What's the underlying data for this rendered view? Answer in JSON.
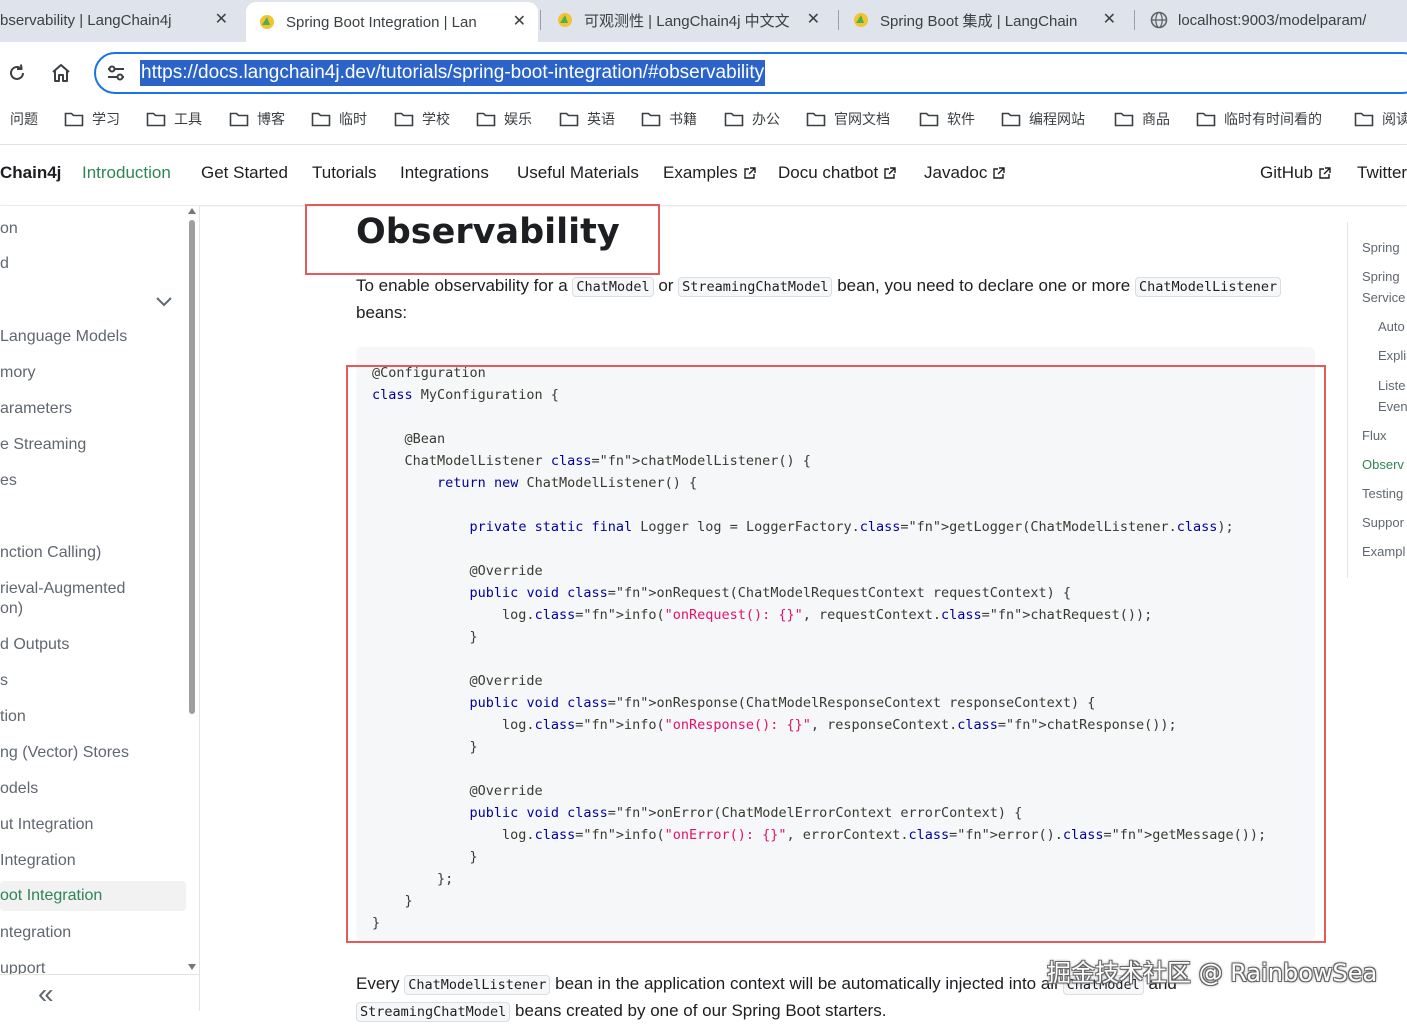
{
  "browser": {
    "tabs": [
      {
        "title": "bservability | LangChain4j",
        "close": "✕",
        "active": false
      },
      {
        "title": "Spring Boot Integration | Lan",
        "close": "✕",
        "active": true
      },
      {
        "title": "可观测性 | LangChain4j 中文文",
        "close": "✕",
        "active": false
      },
      {
        "title": "Spring Boot 集成 | LangChain",
        "close": "✕",
        "active": false
      },
      {
        "title": "localhost:9003/modelparam/",
        "close": "",
        "active": false
      }
    ],
    "url": "https://docs.langchain4j.dev/tutorials/spring-boot-integration/#observability",
    "bookmarks": [
      "问题",
      "学习",
      "工具",
      "博客",
      "临时",
      "学校",
      "娱乐",
      "英语",
      "书籍",
      "办公",
      "官网文档",
      "软件",
      "编程网站",
      "商品",
      "临时有时间看的",
      "阅读"
    ]
  },
  "navbar": {
    "brand": "Chain4j",
    "items": [
      "Introduction",
      "Get Started",
      "Tutorials",
      "Integrations",
      "Useful Materials",
      "Examples",
      "Docu chatbot",
      "Javadoc"
    ],
    "right": [
      "GitHub",
      "Twitter"
    ]
  },
  "sidebar": {
    "items": [
      "on",
      "d",
      "Language Models",
      "mory",
      "arameters",
      "e Streaming",
      "es",
      "nction Calling)",
      "rieval-Augmented",
      "on)",
      "d Outputs",
      "s",
      "tion",
      "ng (Vector) Stores",
      "odels",
      "ut Integration",
      "Integration",
      "oot Integration",
      "ntegration",
      "upport"
    ],
    "collapse_icon": "«"
  },
  "content": {
    "title": "Observability",
    "intro_1": "To enable observability for a",
    "chat_model": "ChatModel",
    "or": "or",
    "streaming_chat_model": "StreamingChatModel",
    "intro_2": "bean, you need to declare one or more",
    "listener": "ChatModelListener",
    "intro_3": "beans:",
    "code_lines": [
      "@Configuration",
      "class MyConfiguration {",
      "",
      "    @Bean",
      "    ChatModelListener chatModelListener() {",
      "        return new ChatModelListener() {",
      "",
      "            private static final Logger log = LoggerFactory.getLogger(ChatModelListener.class);",
      "",
      "            @Override",
      "            public void onRequest(ChatModelRequestContext requestContext) {",
      "                log.info(\"onRequest(): {}\", requestContext.chatRequest());",
      "            }",
      "",
      "            @Override",
      "            public void onResponse(ChatModelResponseContext responseContext) {",
      "                log.info(\"onResponse(): {}\", responseContext.chatResponse());",
      "            }",
      "",
      "            @Override",
      "            public void onError(ChatModelErrorContext errorContext) {",
      "                log.info(\"onError(): {}\", errorContext.error().getMessage());",
      "            }",
      "        };",
      "    }",
      "}"
    ],
    "bottom_1": "Every",
    "bottom_listener": "ChatModelListener",
    "bottom_2": "bean in the application context will be automatically injected into all",
    "bottom_chat_model": "ChatModel",
    "bottom_3": "and",
    "bottom_streaming": "StreamingChatModel",
    "bottom_4": "beans created by one of our Spring Boot starters."
  },
  "toc": {
    "items": [
      "Spring",
      "Spring",
      "Service",
      "Auto",
      "Expli",
      "Liste",
      "Even",
      "Flux",
      "Observ",
      "Testing",
      "Suppor",
      "Exampl"
    ]
  },
  "watermark": "掘金技术社区 @ RainbowSea",
  "colors": {
    "accent": "#2e8555",
    "highlight": "#2b63c9",
    "annotation": "#e25c5c"
  }
}
